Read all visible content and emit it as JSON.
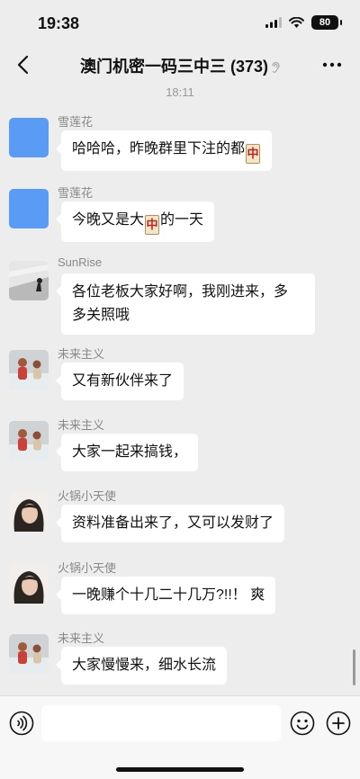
{
  "status_bar": {
    "time": "19:38",
    "battery": "80"
  },
  "header": {
    "title": "澳门机密一码三中三 (373)"
  },
  "chat": {
    "timestamp": "18:11",
    "messages": [
      {
        "sender": "雪莲花",
        "text_before": "哈哈哈，昨晚群里下注的都",
        "tile": "中",
        "text_after": ""
      },
      {
        "sender": "雪莲花",
        "text_before": "今晚又是大",
        "tile": "中",
        "text_after": "的一天"
      },
      {
        "sender": "SunRise",
        "line1": "各位老板大家好啊，我刚进来，多",
        "line2": "多关照哦"
      },
      {
        "sender": "未来主义",
        "text": "又有新伙伴来了"
      },
      {
        "sender": "未来主义",
        "text": "大家一起来搞钱，"
      },
      {
        "sender": "火锅小天使",
        "text": "资料准备出来了，又可以发财了"
      },
      {
        "sender": "火锅小天使",
        "text": "一晚赚个十几二十几万?!!！ 爽"
      },
      {
        "sender": "未来主义",
        "text": "大家慢慢来，细水长流"
      }
    ]
  },
  "colors": {
    "background": "#ededed",
    "bubble": "#ffffff",
    "avatar_blue": "#5a9cf5",
    "tile_red": "#c3231d"
  },
  "icons": [
    "back-icon",
    "ear-icon",
    "more-icon",
    "voice-icon",
    "emoji-icon",
    "plus-icon",
    "signal-icon",
    "wifi-icon",
    "battery-icon"
  ]
}
